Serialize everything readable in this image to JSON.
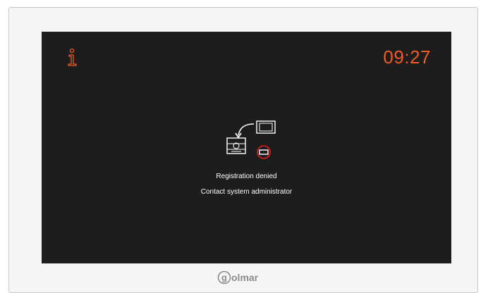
{
  "status": {
    "time": "09:27"
  },
  "message": {
    "line1": "Registration denied",
    "line2": "Contact system administrator"
  },
  "branding": {
    "logo_text": "golmar"
  },
  "icons": {
    "info": "info-icon",
    "registration": "registration-denied-icon",
    "denied": "denied-icon"
  },
  "colors": {
    "accent": "#f15a24",
    "denied": "#e31e24",
    "screen_background": "#1d1d1d"
  }
}
